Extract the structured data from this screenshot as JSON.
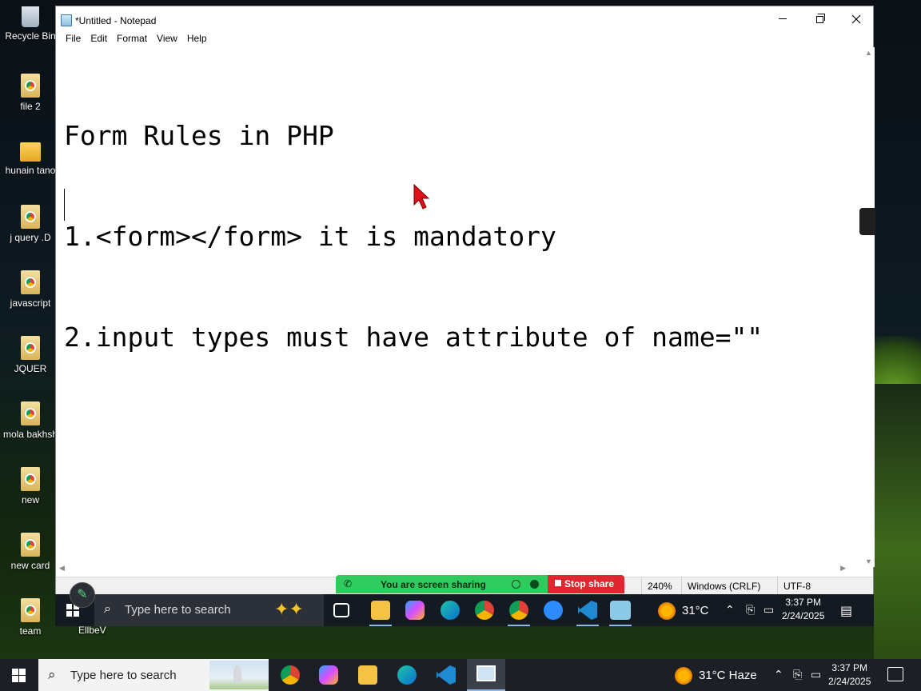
{
  "desktop": {
    "icons": [
      {
        "label": "Recycle Bin",
        "type": "bin"
      },
      {
        "label": "file 2",
        "type": "chrome"
      },
      {
        "label": "hunain tano",
        "type": "folder"
      },
      {
        "label": "j query .D",
        "type": "chrome"
      },
      {
        "label": "javascript",
        "type": "chrome"
      },
      {
        "label": "JQUER",
        "type": "chrome"
      },
      {
        "label": "mola bakhsh",
        "type": "chrome"
      },
      {
        "label": "new",
        "type": "chrome"
      },
      {
        "label": "new card",
        "type": "chrome"
      },
      {
        "label": "team",
        "type": "chrome"
      }
    ],
    "extra_label": "EllbeV"
  },
  "window": {
    "title": "*Untitled - Notepad",
    "menu": [
      "File",
      "Edit",
      "Format",
      "View",
      "Help"
    ],
    "editor_lines": [
      "Form Rules in PHP",
      "1.<form></form> it is mandatory",
      "2.input types must have attribute of name=\"\""
    ],
    "status": {
      "zoom": "240%",
      "line_ending": "Windows (CRLF)",
      "encoding": "UTF-8"
    }
  },
  "screen_share": {
    "banner_text": "You are screen sharing",
    "stop_label": "Stop share"
  },
  "inner_taskbar": {
    "search_placeholder": "Type here to search",
    "weather": "31°C",
    "time": "3:37 PM",
    "date": "2/24/2025"
  },
  "taskbar": {
    "search_placeholder": "Type here to search",
    "weather": "31°C  Haze",
    "time": "3:37 PM",
    "date": "2/24/2025"
  },
  "colors": {
    "share_green": "#2fcb5e",
    "stop_red": "#e0262e",
    "cursor_red": "#e0101a"
  }
}
